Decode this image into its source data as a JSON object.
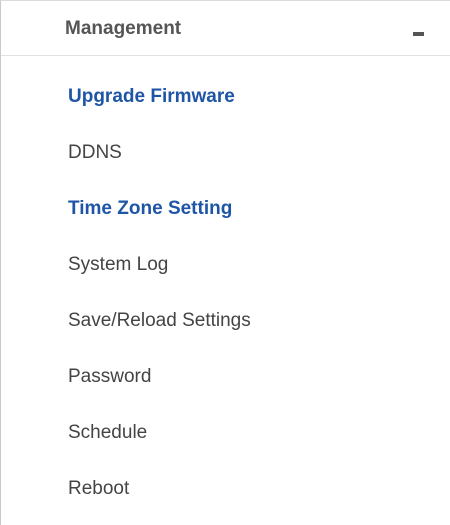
{
  "menu": {
    "title": "Management",
    "collapse_icon": "minus-icon",
    "items": [
      {
        "label": "Upgrade Firmware",
        "active": true
      },
      {
        "label": "DDNS",
        "active": false
      },
      {
        "label": "Time Zone Setting",
        "active": true
      },
      {
        "label": "System Log",
        "active": false
      },
      {
        "label": "Save/Reload Settings",
        "active": false
      },
      {
        "label": "Password",
        "active": false
      },
      {
        "label": "Schedule",
        "active": false
      },
      {
        "label": "Reboot",
        "active": false
      }
    ]
  },
  "colors": {
    "header_text": "#555555",
    "active_link": "#1f55a6",
    "item_text": "#444444"
  }
}
